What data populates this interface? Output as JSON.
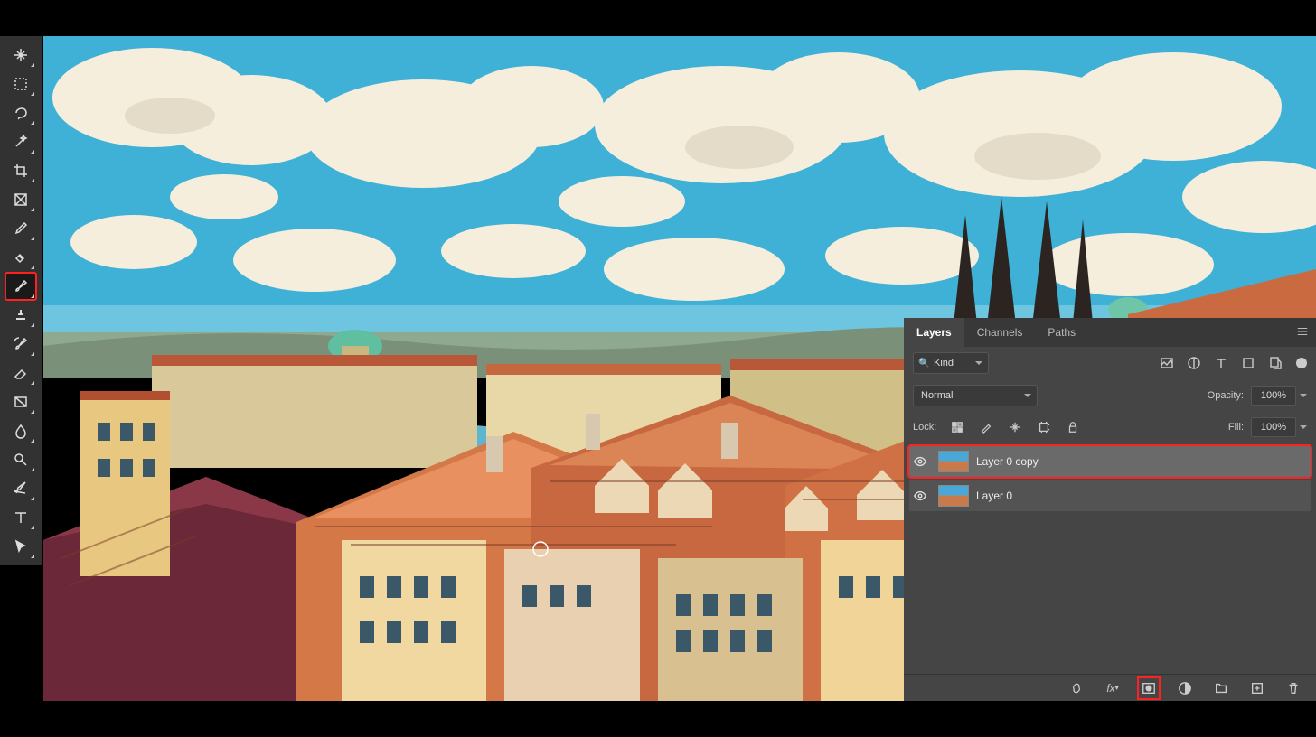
{
  "panel": {
    "tabs": [
      "Layers",
      "Channels",
      "Paths"
    ],
    "active_tab": 0,
    "filter_kind": "Kind",
    "blend_mode": "Normal",
    "opacity_label": "Opacity:",
    "opacity_value": "100%",
    "lock_label": "Lock:",
    "fill_label": "Fill:",
    "fill_value": "100%"
  },
  "layers": [
    {
      "name": "Layer 0 copy",
      "visible": true,
      "selected": true,
      "highlighted": true
    },
    {
      "name": "Layer 0",
      "visible": true,
      "selected": false,
      "highlighted": false
    }
  ],
  "tools": [
    {
      "id": "move",
      "selected": false,
      "highlighted": false
    },
    {
      "id": "marquee",
      "selected": false,
      "highlighted": false
    },
    {
      "id": "lasso",
      "selected": false,
      "highlighted": false
    },
    {
      "id": "wand",
      "selected": false,
      "highlighted": false
    },
    {
      "id": "crop",
      "selected": false,
      "highlighted": false
    },
    {
      "id": "frame",
      "selected": false,
      "highlighted": false
    },
    {
      "id": "eyedropper",
      "selected": false,
      "highlighted": false
    },
    {
      "id": "healing",
      "selected": false,
      "highlighted": false
    },
    {
      "id": "brush",
      "selected": true,
      "highlighted": true
    },
    {
      "id": "stamp",
      "selected": false,
      "highlighted": false
    },
    {
      "id": "history-brush",
      "selected": false,
      "highlighted": false
    },
    {
      "id": "eraser",
      "selected": false,
      "highlighted": false
    },
    {
      "id": "gradient",
      "selected": false,
      "highlighted": false
    },
    {
      "id": "blur",
      "selected": false,
      "highlighted": false
    },
    {
      "id": "dodge",
      "selected": false,
      "highlighted": false
    },
    {
      "id": "pen",
      "selected": false,
      "highlighted": false
    },
    {
      "id": "type",
      "selected": false,
      "highlighted": false
    },
    {
      "id": "path-select",
      "selected": false,
      "highlighted": false
    }
  ],
  "footer_buttons": [
    {
      "id": "link",
      "highlighted": false
    },
    {
      "id": "fx",
      "highlighted": false
    },
    {
      "id": "mask",
      "highlighted": true
    },
    {
      "id": "adjustment",
      "highlighted": false
    },
    {
      "id": "group",
      "highlighted": false
    },
    {
      "id": "new-layer",
      "highlighted": false
    },
    {
      "id": "trash",
      "highlighted": false
    }
  ]
}
